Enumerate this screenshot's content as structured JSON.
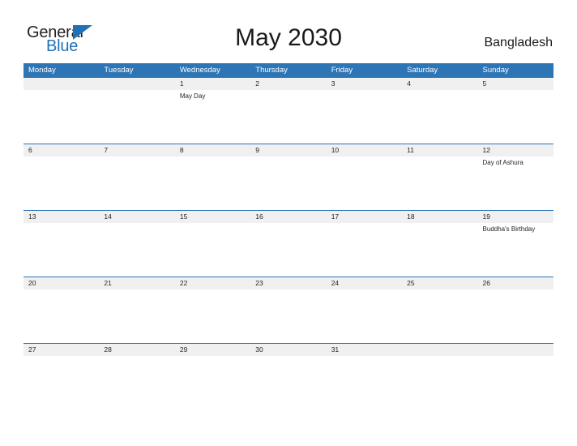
{
  "header": {
    "logo": {
      "word_one": "General",
      "word_two": "Blue",
      "triangle_color": "#1f72b8"
    },
    "title": "May 2030",
    "country": "Bangladesh"
  },
  "calendar": {
    "accent_color": "#2e75b6",
    "band_color": "#f0f0f0",
    "day_headers": [
      "Monday",
      "Tuesday",
      "Wednesday",
      "Thursday",
      "Friday",
      "Saturday",
      "Sunday"
    ],
    "weeks": [
      {
        "days": [
          {
            "num": "",
            "event": ""
          },
          {
            "num": "",
            "event": ""
          },
          {
            "num": "1",
            "event": "May Day"
          },
          {
            "num": "2",
            "event": ""
          },
          {
            "num": "3",
            "event": ""
          },
          {
            "num": "4",
            "event": ""
          },
          {
            "num": "5",
            "event": ""
          }
        ]
      },
      {
        "days": [
          {
            "num": "6",
            "event": ""
          },
          {
            "num": "7",
            "event": ""
          },
          {
            "num": "8",
            "event": ""
          },
          {
            "num": "9",
            "event": ""
          },
          {
            "num": "10",
            "event": ""
          },
          {
            "num": "11",
            "event": ""
          },
          {
            "num": "12",
            "event": "Day of Ashura"
          }
        ]
      },
      {
        "days": [
          {
            "num": "13",
            "event": ""
          },
          {
            "num": "14",
            "event": ""
          },
          {
            "num": "15",
            "event": ""
          },
          {
            "num": "16",
            "event": ""
          },
          {
            "num": "17",
            "event": ""
          },
          {
            "num": "18",
            "event": ""
          },
          {
            "num": "19",
            "event": "Buddha's Birthday"
          }
        ]
      },
      {
        "days": [
          {
            "num": "20",
            "event": ""
          },
          {
            "num": "21",
            "event": ""
          },
          {
            "num": "22",
            "event": ""
          },
          {
            "num": "23",
            "event": ""
          },
          {
            "num": "24",
            "event": ""
          },
          {
            "num": "25",
            "event": ""
          },
          {
            "num": "26",
            "event": ""
          }
        ]
      },
      {
        "days": [
          {
            "num": "27",
            "event": ""
          },
          {
            "num": "28",
            "event": ""
          },
          {
            "num": "29",
            "event": ""
          },
          {
            "num": "30",
            "event": ""
          },
          {
            "num": "31",
            "event": ""
          },
          {
            "num": "",
            "event": ""
          },
          {
            "num": "",
            "event": ""
          }
        ]
      }
    ]
  }
}
